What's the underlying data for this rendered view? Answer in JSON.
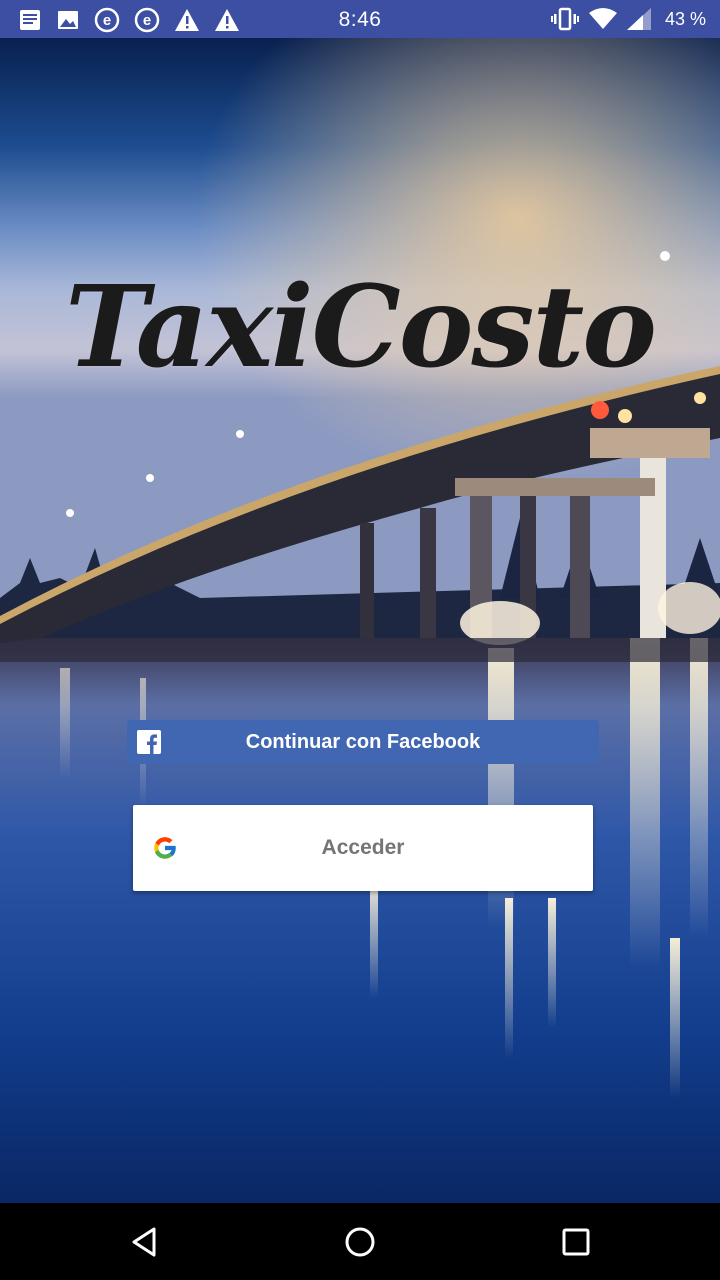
{
  "status_bar": {
    "time": "8:46",
    "battery": "43 %",
    "left_icons": [
      "notes-icon",
      "image-icon",
      "e-app-icon",
      "e-app-icon",
      "warning-icon",
      "warning-icon"
    ],
    "right_icons": [
      "vibrate-icon",
      "wifi-icon",
      "signal-icon"
    ],
    "color": "#3c4fa2"
  },
  "app": {
    "logo_text": "TaxiCosto"
  },
  "buttons": {
    "facebook_label": "Continuar con Facebook",
    "facebook_color": "#4267b2",
    "google_label": "Acceder"
  },
  "nav_bar": {
    "icons": [
      "back-icon",
      "home-icon",
      "recents-icon"
    ]
  }
}
